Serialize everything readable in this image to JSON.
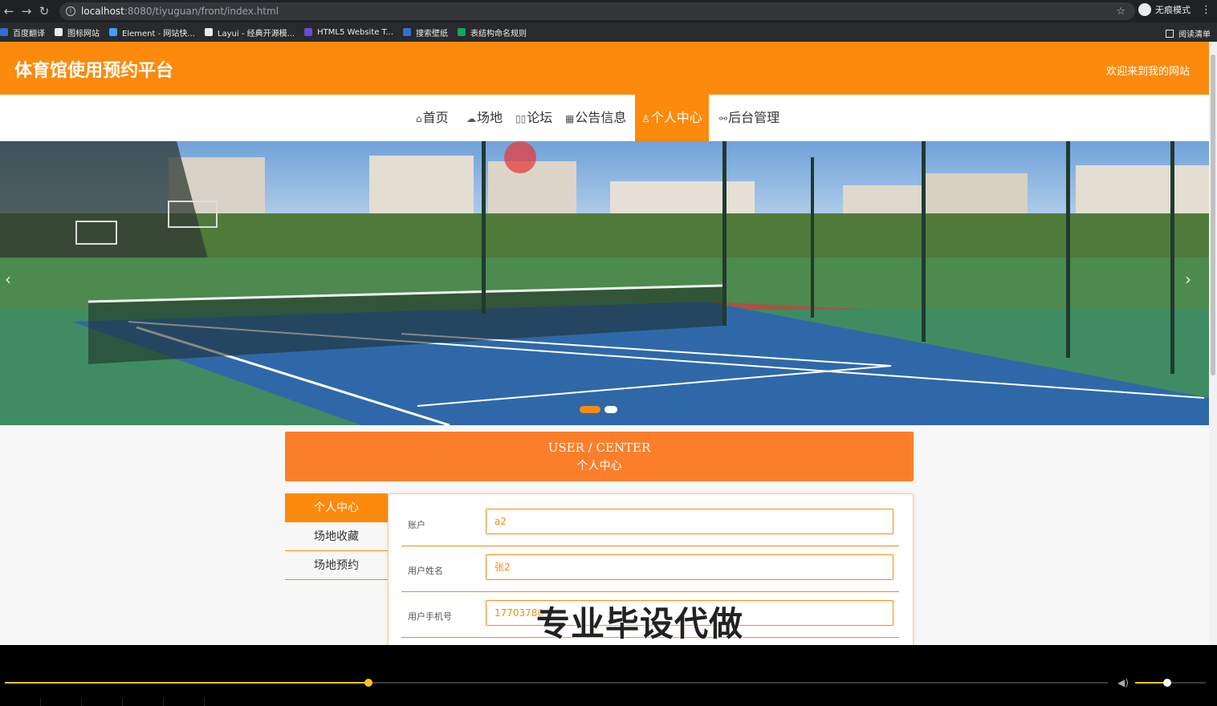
{
  "browser": {
    "url_host": "localhost",
    "url_path": ":8080/tiyuguan/front/index.html",
    "incognito_label": "无痕模式",
    "bookmarks": [
      {
        "label": "百度翻译",
        "color": "#2f6ed8"
      },
      {
        "label": "图标网站",
        "color": "#e8eaed"
      },
      {
        "label": "Element - 网站快...",
        "color": "#409eff"
      },
      {
        "label": "Layui - 经典开源模...",
        "color": "#e8eaed"
      },
      {
        "label": "HTML5 Website T...",
        "color": "#6a4bd6"
      },
      {
        "label": "搜索壁纸",
        "color": "#2f6ed8"
      },
      {
        "label": "表结构命名规则",
        "color": "#1aa260"
      }
    ],
    "reading_list": "阅读清单"
  },
  "site": {
    "title": "体育馆使用预约平台",
    "welcome": "欢迎来到我的网站",
    "accent_color": "#fb8a0d"
  },
  "nav": {
    "items": [
      {
        "icon": "home-icon",
        "glyph": "⌂",
        "label": "首页"
      },
      {
        "icon": "cloud-icon",
        "glyph": "☁",
        "label": "场地"
      },
      {
        "icon": "forum-icon",
        "glyph": "▯▯",
        "label": "论坛"
      },
      {
        "icon": "notice-icon",
        "glyph": "▦",
        "label": "公告信息"
      },
      {
        "icon": "user-icon",
        "glyph": "♙",
        "label": "个人中心"
      },
      {
        "icon": "link-icon",
        "glyph": "⚯",
        "label": "后台管理"
      }
    ],
    "active_index": 4
  },
  "banner": {
    "slide_count": 2,
    "active_slide": 1
  },
  "user_center": {
    "title_en": "USER / CENTER",
    "title_cn": "个人中心",
    "side_menu": [
      "个人中心",
      "场地收藏",
      "场地预约"
    ],
    "fields": [
      {
        "label": "账户",
        "value": "a2"
      },
      {
        "label": "用户姓名",
        "value": "张2"
      },
      {
        "label": "用户手机号",
        "value": "17703786"
      }
    ]
  },
  "overlay": {
    "watermark": "专业毕设代做"
  },
  "player": {
    "progress": 0.33,
    "volume": 0.45
  }
}
